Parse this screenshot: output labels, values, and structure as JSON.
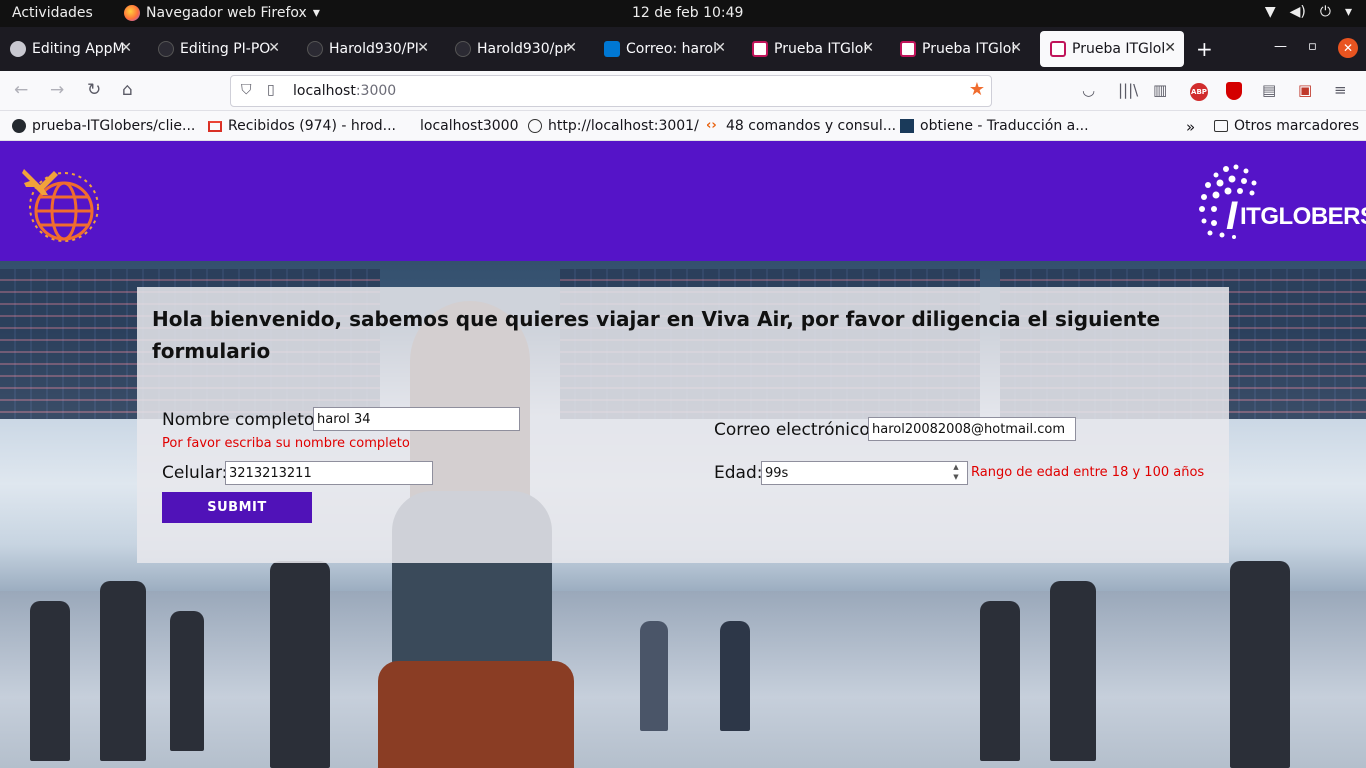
{
  "system_bar": {
    "activities": "Actividades",
    "app_name": "Navegador web Firefox",
    "clock": "12 de feb  10:49"
  },
  "tabs": [
    {
      "label": "Editing AppM",
      "icon_color": "#24292f"
    },
    {
      "label": "Editing PI-PO",
      "icon_color": "#24292f"
    },
    {
      "label": "Harold930/PI-",
      "icon_color": "#24292f"
    },
    {
      "label": "Harold930/pr",
      "icon_color": "#24292f"
    },
    {
      "label": "Correo: harol",
      "icon_color": "#0078d4"
    },
    {
      "label": "Prueba ITGlob",
      "icon_color": "#c0145a"
    },
    {
      "label": "Prueba ITGlob",
      "icon_color": "#c0145a"
    },
    {
      "label": "Prueba ITGlob",
      "icon_color": "#c0145a",
      "active": true
    }
  ],
  "navbar": {
    "url_host": "localhost",
    "url_port": ":3000"
  },
  "bookmarks": [
    {
      "label": "prueba-ITGlobers/clie...",
      "icon": "github-icon"
    },
    {
      "label": "Recibidos (974) - hrod...",
      "icon": "gmail-icon"
    },
    {
      "label": "localhost3000",
      "icon": "blank-icon"
    },
    {
      "label": "http://localhost:3001/",
      "icon": "globe-icon"
    },
    {
      "label": "48 comandos y consul...",
      "icon": "code-icon"
    },
    {
      "label": "obtiene - Traducción a...",
      "icon": "dictionary-icon"
    },
    {
      "label": "Otros marcadores",
      "icon": "folder-icon"
    }
  ],
  "site": {
    "header_color": "#5514c8",
    "logo_text": "ITGLOBERS"
  },
  "form": {
    "title": "Hola bienvenido, sabemos que quieres viajar en Viva Air, por favor diligencia el siguiente formulario",
    "name_label": "Nombre completo:",
    "name_value": "harol 34",
    "name_error": "Por favor escriba su nombre completo",
    "email_label": "Correo electrónico:",
    "email_value": "harol20082008@hotmail.com",
    "phone_label": "Celular:",
    "phone_value": "3213213211",
    "age_label": "Edad:",
    "age_value": "99s",
    "age_error": "Rango de edad entre 18 y 100 años",
    "submit_label": "SUBMIT"
  }
}
